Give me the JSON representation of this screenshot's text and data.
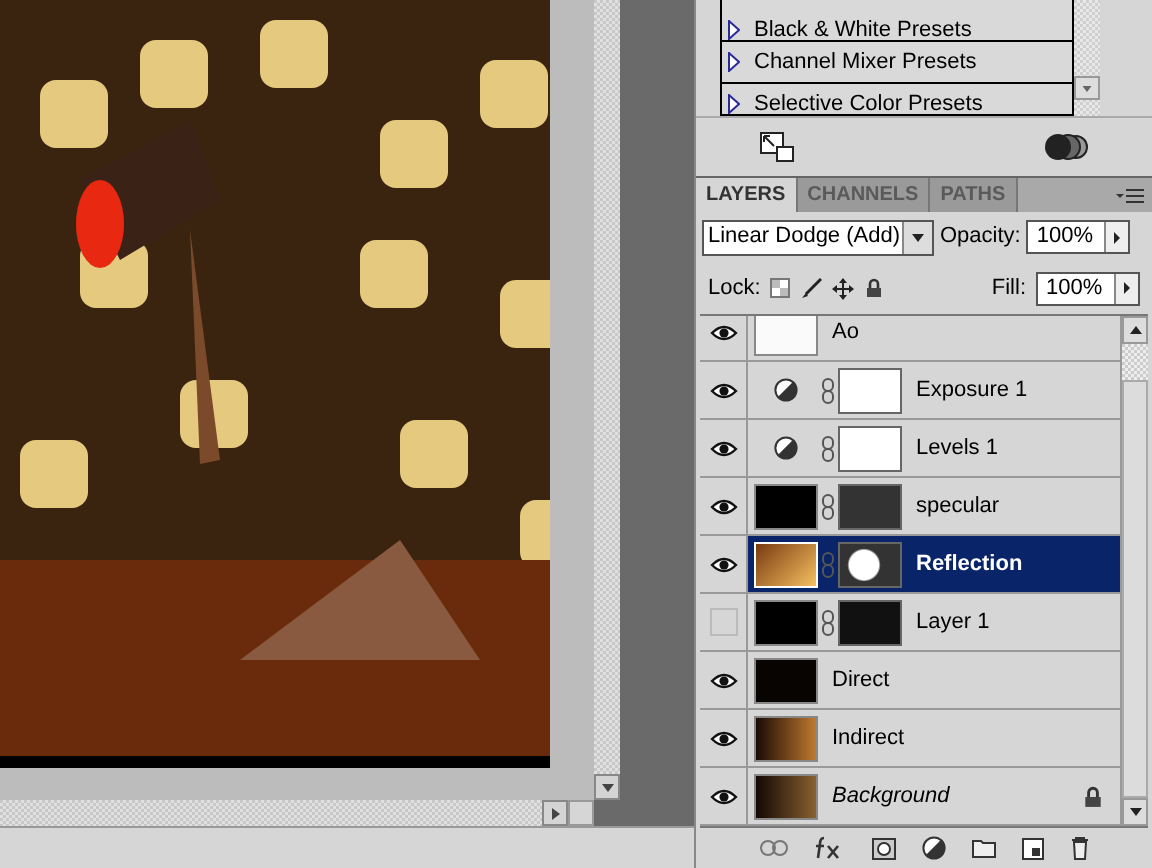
{
  "presets": [
    {
      "label": "Black & White Presets"
    },
    {
      "label": "Channel Mixer Presets"
    },
    {
      "label": "Selective Color Presets"
    }
  ],
  "tabs": [
    {
      "label": "LAYERS",
      "selected": true
    },
    {
      "label": "CHANNELS",
      "selected": false
    },
    {
      "label": "PATHS",
      "selected": false
    }
  ],
  "blend_mode": "Linear Dodge (Add)",
  "opacity": {
    "label": "Opacity:",
    "value": "100%"
  },
  "lock": {
    "label": "Lock:"
  },
  "fill": {
    "label": "Fill:",
    "value": "100%"
  },
  "layers": [
    {
      "name": "Ao",
      "visible": true,
      "mask": false,
      "selected": false,
      "locked": false,
      "italic": false
    },
    {
      "name": "Exposure 1",
      "kind": "adjustment",
      "visible": true,
      "mask": true,
      "selected": false,
      "locked": false,
      "italic": false
    },
    {
      "name": "Levels 1",
      "kind": "adjustment",
      "visible": true,
      "mask": true,
      "selected": false,
      "locked": false,
      "italic": false
    },
    {
      "name": "specular",
      "visible": true,
      "mask": true,
      "selected": false,
      "locked": false,
      "italic": false
    },
    {
      "name": "Reflection",
      "visible": true,
      "mask": true,
      "selected": true,
      "locked": false,
      "italic": false
    },
    {
      "name": "Layer 1",
      "visible": false,
      "mask": true,
      "selected": false,
      "locked": false,
      "italic": false
    },
    {
      "name": "Direct",
      "visible": true,
      "mask": false,
      "selected": false,
      "locked": false,
      "italic": false
    },
    {
      "name": "Indirect",
      "visible": true,
      "mask": false,
      "selected": false,
      "locked": false,
      "italic": false
    },
    {
      "name": "Background",
      "visible": true,
      "mask": false,
      "selected": false,
      "locked": true,
      "italic": true
    }
  ]
}
